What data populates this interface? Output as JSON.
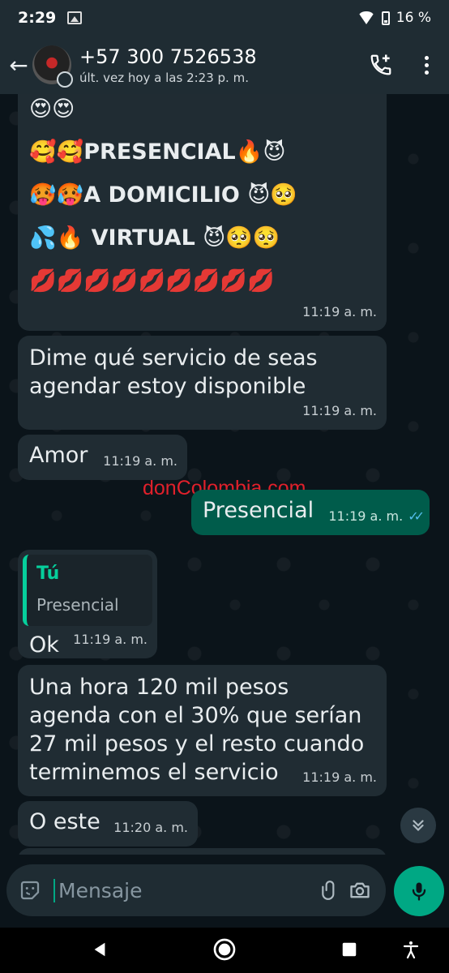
{
  "status_bar": {
    "time": "2:29",
    "battery": "16 %"
  },
  "header": {
    "contact_name": "+57 300 7526538",
    "last_seen": "últ. vez hoy a las 2:23 p. m."
  },
  "messages": [
    {
      "direction": "in",
      "lines": [
        "😍😍",
        "🥰🥰PRESENCIAL🔥😈",
        "🥵🥵A DOMICILIO 😈🥺",
        "💦🔥 VIRTUAL 😈🥺🥺",
        "💋💋💋💋💋💋💋💋💋"
      ],
      "time": "11:19 a. m."
    },
    {
      "direction": "in",
      "text": "Dime qué servicio de seas agendar estoy disponible",
      "time": "11:19 a. m."
    },
    {
      "direction": "in",
      "text": "Amor",
      "time": "11:19 a. m."
    },
    {
      "direction": "out",
      "text": "Presencial",
      "time": "11:19 a. m.",
      "status": "read"
    },
    {
      "direction": "in",
      "quote": {
        "author": "Tú",
        "text": "Presencial"
      },
      "text": "Ok",
      "time": "11:19 a. m."
    },
    {
      "direction": "in",
      "text": "Una hora 120 mil pesos agenda con el 30% que serían 27 mil pesos y el resto cuando terminemos el servicio",
      "time": "11:19 a. m."
    },
    {
      "direction": "in",
      "text": "O este",
      "time": "11:20 a. m."
    }
  ],
  "watermark": "donColombia.com",
  "input": {
    "placeholder": "Mensaje"
  },
  "icons": {
    "back": "arrow-left-icon",
    "call_add": "add-call-icon",
    "menu": "more-vertical-icon",
    "emoji": "sticker-icon",
    "attach": "paperclip-icon",
    "camera": "camera-icon",
    "mic": "mic-icon",
    "scroll": "chevrons-down-icon"
  },
  "colors": {
    "incoming": "#202c33",
    "outgoing": "#005c4b",
    "accent": "#00a884",
    "read_ticks": "#53bdeb"
  }
}
